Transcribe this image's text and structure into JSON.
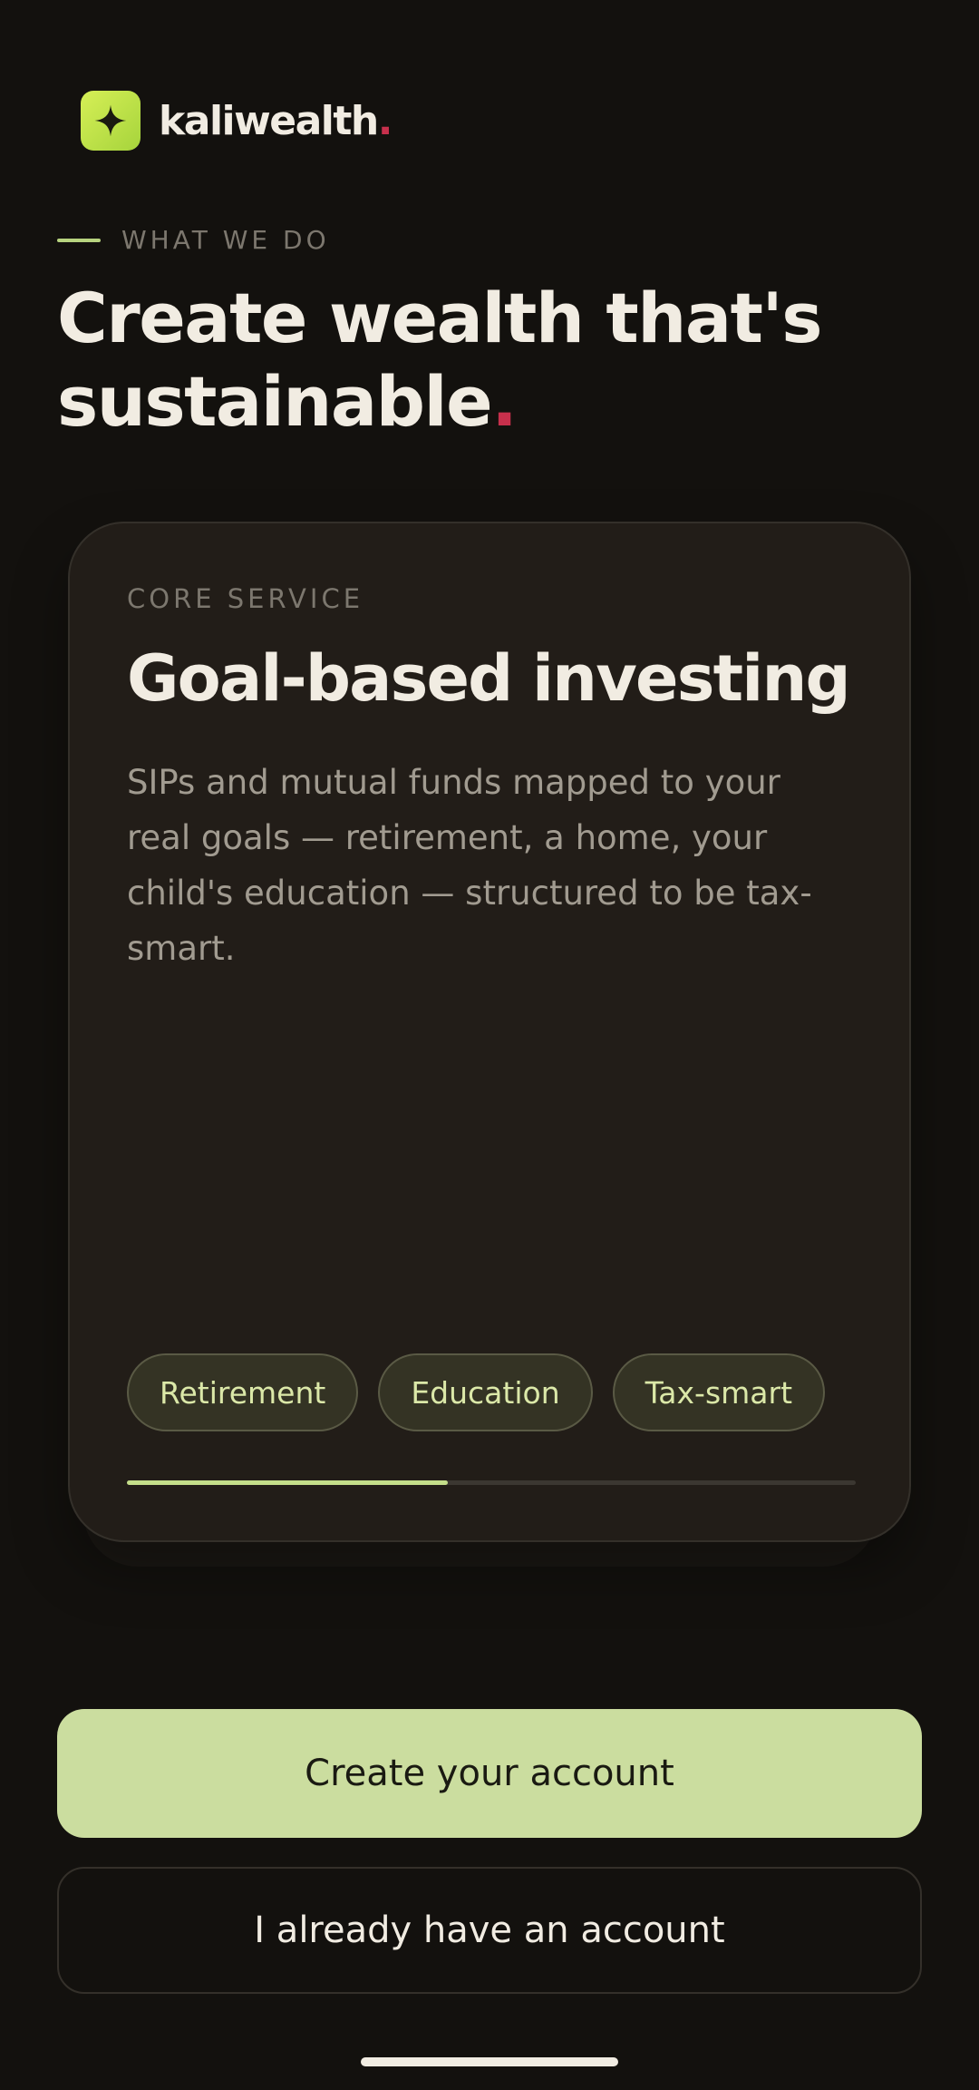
{
  "brand": {
    "name": "kaliwealth",
    "dot": ".",
    "logo_icon": "sparkle-icon",
    "logo_color": "#c9e64a"
  },
  "hero": {
    "eyebrow": "WHAT WE DO",
    "title": "Create wealth that's sustainable",
    "title_dot": "."
  },
  "card": {
    "eyebrow": "CORE SERVICE",
    "title": "Goal-based investing",
    "description": "SIPs and mutual funds mapped to your real goals — retirement, a home, your child's education — structured to be tax-smart.",
    "chips": [
      "Retirement",
      "Education",
      "Tax-smart"
    ],
    "progress": 0.44
  },
  "actions": {
    "primary_label": "Create your account",
    "secondary_label": "I already have an account"
  },
  "colors": {
    "background": "#13110e",
    "accent": "#cbdd9f",
    "brand_red": "#c7304c",
    "card": "#221d18"
  }
}
